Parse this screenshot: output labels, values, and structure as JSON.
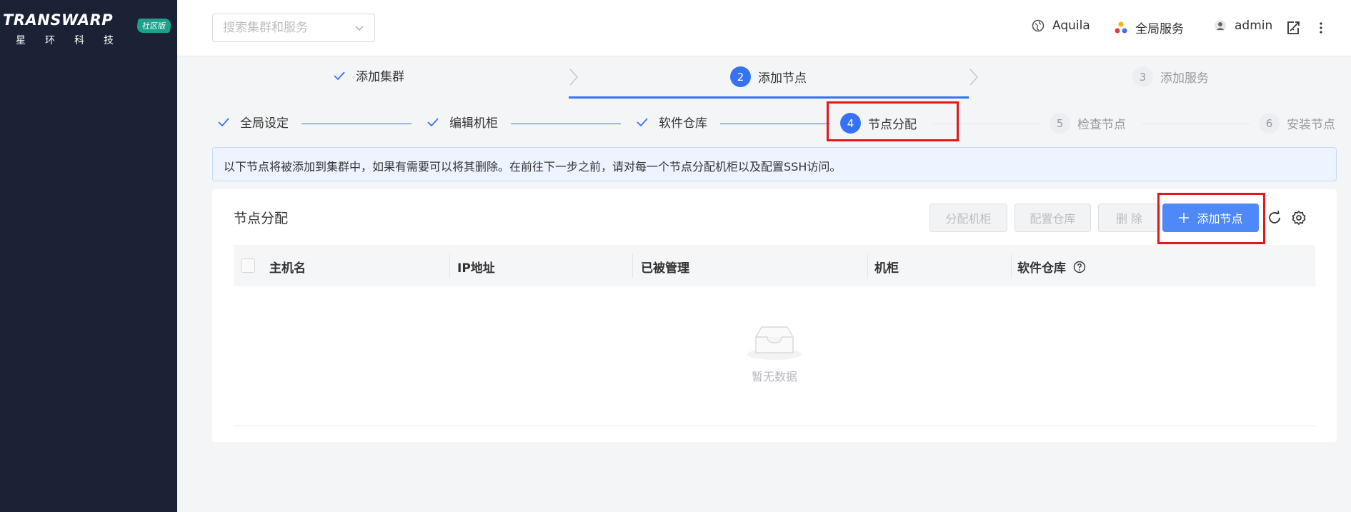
{
  "brand": {
    "name": "TRANSWARP",
    "badge": "社区版",
    "subtitle": "星环科技"
  },
  "header": {
    "search_placeholder": "搜索集群和服务",
    "items": [
      {
        "label": "Aquila",
        "icon": "globe-icon"
      },
      {
        "label": "全局服务",
        "icon": "services-icon"
      },
      {
        "label": "admin",
        "icon": "user-icon"
      }
    ],
    "extra_icons": [
      "export-icon",
      "more-vertical-icon"
    ]
  },
  "wizard": {
    "steps": [
      {
        "label": "添加集群",
        "status": "done"
      },
      {
        "label": "添加节点",
        "status": "active",
        "number": "2"
      },
      {
        "label": "添加服务",
        "status": "wait",
        "number": "3"
      }
    ]
  },
  "substeps": {
    "steps": [
      {
        "label": "全局设定",
        "status": "done"
      },
      {
        "label": "编辑机柜",
        "status": "done"
      },
      {
        "label": "软件仓库",
        "status": "done"
      },
      {
        "label": "节点分配",
        "status": "active",
        "number": "4"
      },
      {
        "label": "检查节点",
        "status": "wait",
        "number": "5"
      },
      {
        "label": "安装节点",
        "status": "wait",
        "number": "6"
      }
    ]
  },
  "alert": {
    "text": "以下节点将被添加到集群中，如果有需要可以将其删除。在前往下一步之前，请对每一个节点分配机柜以及配置SSH访问。"
  },
  "panel": {
    "title": "节点分配",
    "buttons": {
      "assign_rack": "分配机柜",
      "config_repo": "配置仓库",
      "delete": "删 除",
      "add_node": "添加节点"
    },
    "columns": [
      "主机名",
      "IP地址",
      "已被管理",
      "机柜",
      "软件仓库"
    ],
    "empty_text": "暂无数据"
  },
  "colors": {
    "primary": "#3573f4",
    "sidebar": "#1b2236",
    "highlight": "#e3161a"
  }
}
